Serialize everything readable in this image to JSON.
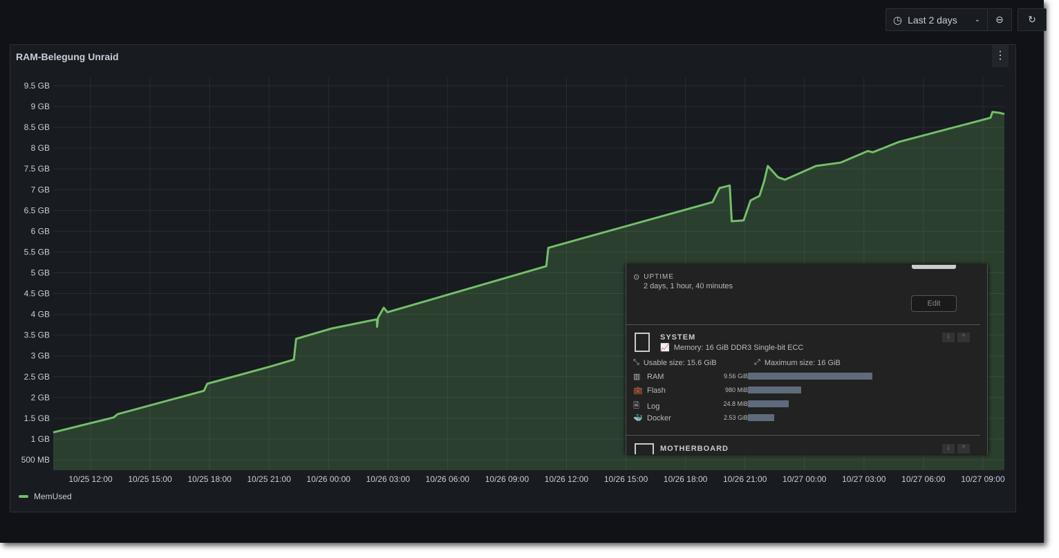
{
  "toolbar": {
    "time_range": "Last 2 days",
    "clock_icon": "clock-icon",
    "zoom_out_icon": "zoom-out-icon",
    "refresh_icon": "refresh-icon"
  },
  "panel": {
    "title": "RAM-Belegung Unraid",
    "menu_icon": "more-vertical-icon"
  },
  "chart_data": {
    "type": "area",
    "title": "RAM-Belegung Unraid",
    "xlabel": "",
    "ylabel": "",
    "grid": true,
    "legend_placement": "bottom-left",
    "series": [
      {
        "name": "MemUsed",
        "color": "#73bf69",
        "unit": "GB",
        "x": [
          "10/25 10:07",
          "10/25 13:10",
          "10/25 13:22",
          "10/25 17:43",
          "10/25 17:53",
          "10/25 21:02",
          "10/25 22:15",
          "10/25 22:22",
          "10/26 00:10",
          "10/26 02:26",
          "10/26 02:27",
          "10/26 02:30",
          "10/26 02:47",
          "10/26 02:58",
          "10/26 10:59",
          "10/26 11:05",
          "10/26 19:22",
          "10/26 19:43",
          "10/26 20:14",
          "10/26 20:20",
          "10/26 20:56",
          "10/26 21:17",
          "10/26 21:44",
          "10/26 21:58",
          "10/26 22:09",
          "10/26 22:40",
          "10/26 23:01",
          "10/27 00:35",
          "10/27 01:49",
          "10/27 03:12",
          "10/27 03:27",
          "10/27 04:46",
          "10/27 09:23",
          "10/27 09:29",
          "10/27 09:50",
          "10/27 10:05"
        ],
        "y": [
          1.16,
          1.52,
          1.6,
          2.16,
          2.33,
          2.74,
          2.91,
          3.41,
          3.66,
          3.88,
          3.7,
          3.92,
          4.16,
          4.05,
          5.16,
          5.6,
          6.7,
          7.04,
          7.1,
          6.24,
          6.26,
          6.74,
          6.85,
          7.2,
          7.57,
          7.3,
          7.24,
          7.57,
          7.65,
          7.93,
          7.9,
          8.15,
          8.73,
          8.87,
          8.85,
          8.82
        ]
      }
    ],
    "y_ticks": [
      "500 MB",
      "1 GB",
      "1.5 GB",
      "2 GB",
      "2.5 GB",
      "3 GB",
      "3.5 GB",
      "4 GB",
      "4.5 GB",
      "5 GB",
      "5.5 GB",
      "6 GB",
      "6.5 GB",
      "7 GB",
      "7.5 GB",
      "8 GB",
      "8.5 GB",
      "9 GB",
      "9.5 GB"
    ],
    "y_tick_values": [
      0.5,
      1,
      1.5,
      2,
      2.5,
      3,
      3.5,
      4,
      4.5,
      5,
      5.5,
      6,
      6.5,
      7,
      7.5,
      8,
      8.5,
      9,
      9.5
    ],
    "ylim": [
      0.25,
      9.7
    ],
    "x_ticks": [
      "10/25 12:00",
      "10/25 15:00",
      "10/25 18:00",
      "10/25 21:00",
      "10/26 00:00",
      "10/26 03:00",
      "10/26 06:00",
      "10/26 09:00",
      "10/26 12:00",
      "10/26 15:00",
      "10/26 18:00",
      "10/26 21:00",
      "10/27 00:00",
      "10/27 03:00",
      "10/27 06:00",
      "10/27 09:00"
    ],
    "xlim": [
      "10/25 10:07",
      "10/27 10:05"
    ]
  },
  "overlay": {
    "uptime_label": "UPTIME",
    "uptime_value": "2 days, 1 hour, 40 minutes",
    "edit_button": "Edit",
    "system_title": "SYSTEM",
    "memory_line": "Memory: 16 GiB DDR3 Single-bit ECC",
    "usable": "Usable size: 15.6 GiB",
    "maximum": "Maximum size: 16 GiB",
    "rows": [
      {
        "label": "RAM",
        "value": "9.56 GiB",
        "fill": 1.0
      },
      {
        "label": "Flash",
        "value": "980 MiB",
        "fill": 0.43
      },
      {
        "label": "Log",
        "value": "24.8 MiB",
        "fill": 0.33
      },
      {
        "label": "Docker",
        "value": "2.53 GiB",
        "fill": 0.21
      }
    ],
    "motherboard_title": "MOTHERBOARD"
  }
}
